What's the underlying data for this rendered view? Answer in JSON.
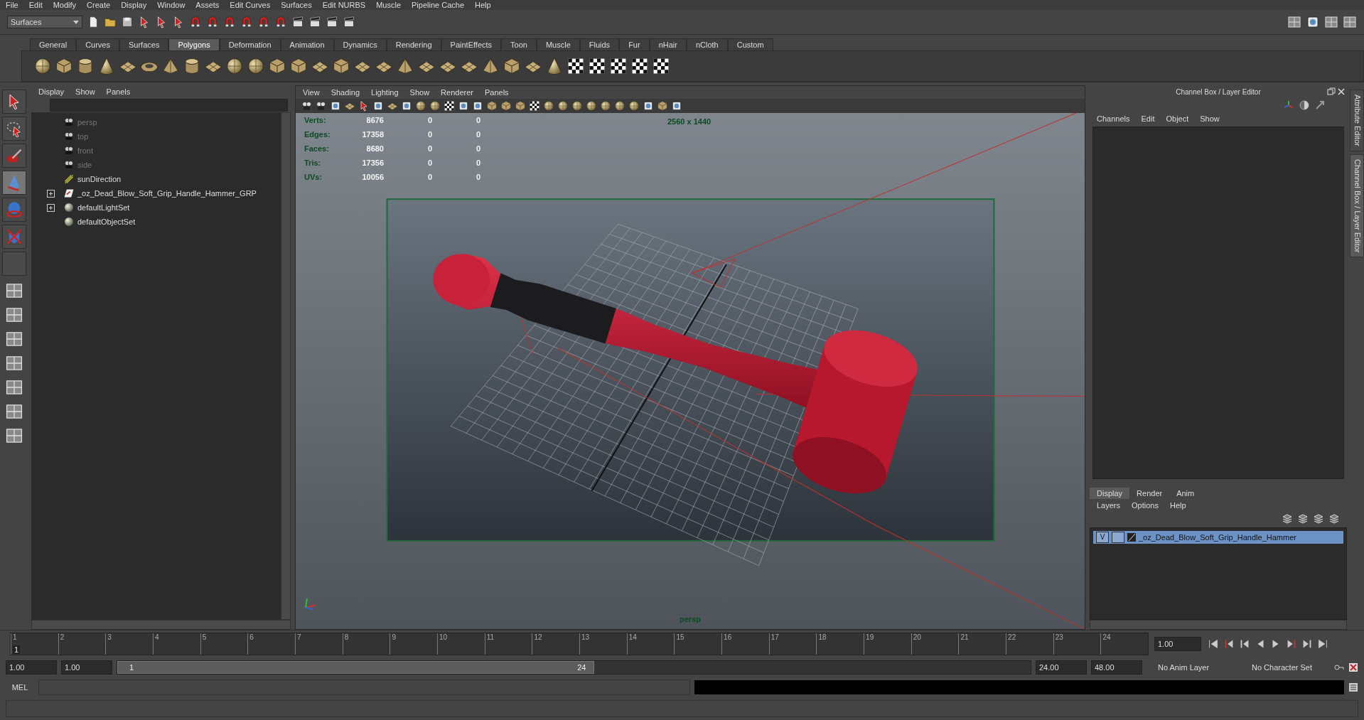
{
  "menu_bar": [
    "File",
    "Edit",
    "Modify",
    "Create",
    "Display",
    "Window",
    "Assets",
    "Edit Curves",
    "Surfaces",
    "Edit NURBS",
    "Muscle",
    "Pipeline Cache",
    "Help"
  ],
  "status_line": {
    "menu_set": "Surfaces"
  },
  "shelf_tabs": [
    {
      "label": "General",
      "selected": false
    },
    {
      "label": "Curves",
      "selected": false
    },
    {
      "label": "Surfaces",
      "selected": false
    },
    {
      "label": "Polygons",
      "selected": true
    },
    {
      "label": "Deformation",
      "selected": false
    },
    {
      "label": "Animation",
      "selected": false
    },
    {
      "label": "Dynamics",
      "selected": false
    },
    {
      "label": "Rendering",
      "selected": false
    },
    {
      "label": "PaintEffects",
      "selected": false
    },
    {
      "label": "Toon",
      "selected": false
    },
    {
      "label": "Muscle",
      "selected": false
    },
    {
      "label": "Fluids",
      "selected": false
    },
    {
      "label": "Fur",
      "selected": false
    },
    {
      "label": "nHair",
      "selected": false
    },
    {
      "label": "nCloth",
      "selected": false
    },
    {
      "label": "Custom",
      "selected": false
    }
  ],
  "outliner": {
    "menu": [
      "Display",
      "Show",
      "Panels"
    ],
    "items": [
      {
        "label": "persp",
        "kind": "camera",
        "dimmed": true,
        "expandable": false
      },
      {
        "label": "top",
        "kind": "camera",
        "dimmed": true,
        "expandable": false
      },
      {
        "label": "front",
        "kind": "camera",
        "dimmed": true,
        "expandable": false
      },
      {
        "label": "side",
        "kind": "camera",
        "dimmed": true,
        "expandable": false
      },
      {
        "label": "sunDirection",
        "kind": "light",
        "dimmed": false,
        "expandable": false
      },
      {
        "label": "_oz_Dead_Blow_Soft_Grip_Handle_Hammer_GRP",
        "kind": "group",
        "dimmed": false,
        "expandable": true
      },
      {
        "label": "defaultLightSet",
        "kind": "set",
        "dimmed": false,
        "expandable": true
      },
      {
        "label": "defaultObjectSet",
        "kind": "set",
        "dimmed": false,
        "expandable": false
      }
    ]
  },
  "viewport": {
    "menu": [
      "View",
      "Shading",
      "Lighting",
      "Show",
      "Renderer",
      "Panels"
    ],
    "hud": [
      {
        "label": "Verts:",
        "values": [
          "8676",
          "0",
          "0"
        ]
      },
      {
        "label": "Edges:",
        "values": [
          "17358",
          "0",
          "0"
        ]
      },
      {
        "label": "Faces:",
        "values": [
          "8680",
          "0",
          "0"
        ]
      },
      {
        "label": "Tris:",
        "values": [
          "17356",
          "0",
          "0"
        ]
      },
      {
        "label": "UVs:",
        "values": [
          "10056",
          "0",
          "0"
        ]
      }
    ],
    "resolution": "2560 x 1440",
    "camera": "persp"
  },
  "channel_box": {
    "title": "Channel Box / Layer Editor",
    "menu": [
      "Channels",
      "Edit",
      "Object",
      "Show"
    ]
  },
  "layer_editor": {
    "tabs": [
      {
        "label": "Display",
        "selected": true
      },
      {
        "label": "Render",
        "selected": false
      },
      {
        "label": "Anim",
        "selected": false
      }
    ],
    "menu": [
      "Layers",
      "Options",
      "Help"
    ],
    "layers": [
      {
        "visibility": "V",
        "name": "_oz_Dead_Blow_Soft_Grip_Handle_Hammer",
        "selected": true
      }
    ]
  },
  "side_tabs": [
    "Attribute Editor",
    "Channel Box / Layer Editor"
  ],
  "time_slider": {
    "frames": [
      "1",
      "2",
      "3",
      "4",
      "5",
      "6",
      "7",
      "8",
      "9",
      "10",
      "11",
      "12",
      "13",
      "14",
      "15",
      "16",
      "17",
      "18",
      "19",
      "20",
      "21",
      "22",
      "23",
      "24"
    ],
    "current_frame": "1",
    "level": 0,
    "current_time": "1.00"
  },
  "range_slider": {
    "start_time": "1.00",
    "playback_start": "1.00",
    "range_start": "1",
    "range_end": "24",
    "level": 0.5,
    "playback_end": "24.00",
    "end_time": "48.00",
    "anim_layer": "No Anim Layer",
    "character_set": "No Character Set"
  },
  "command_line": {
    "label": "MEL"
  }
}
